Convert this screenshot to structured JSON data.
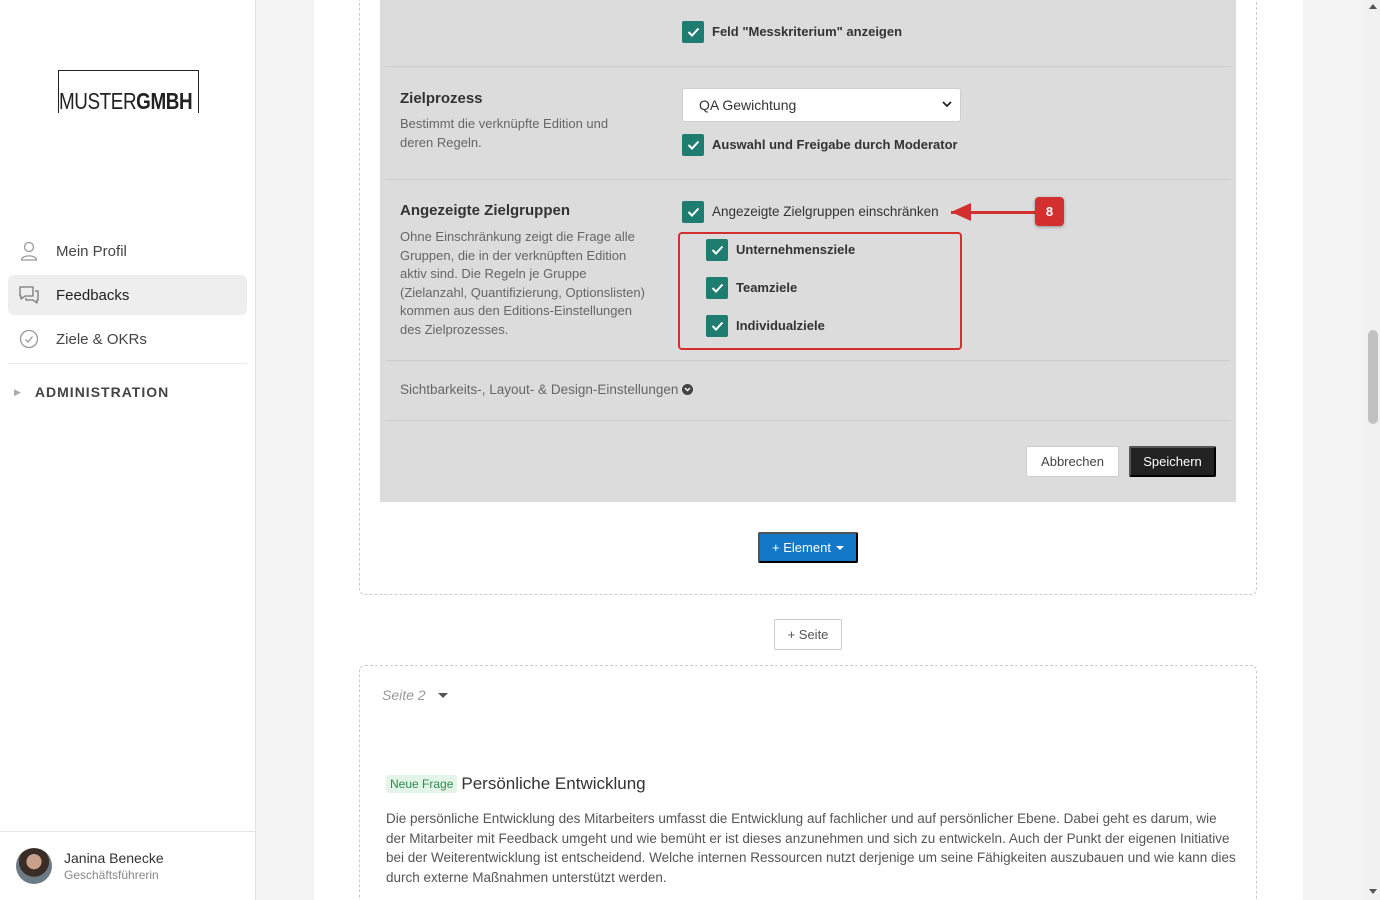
{
  "brand": {
    "logo_light": "MUSTER",
    "logo_bold": "GMBH"
  },
  "sidebar": {
    "items": [
      {
        "label": "Mein Profil",
        "icon": "user-icon"
      },
      {
        "label": "Feedbacks",
        "icon": "chat-icon",
        "active": true
      },
      {
        "label": "Ziele & OKRs",
        "icon": "check-circle-icon"
      }
    ],
    "admin_label": "ADMINISTRATION"
  },
  "user": {
    "name": "Janina Benecke",
    "role": "Geschäftsführerin"
  },
  "editor": {
    "messkriterium_label": "Feld \"Messkriterium\" anzeigen",
    "zielprozess": {
      "title": "Zielprozess",
      "desc": "Bestimmt die verknüpfte Edition und deren Regeln.",
      "select_value": "QA Gewichtung",
      "moderator_label": "Auswahl und Freigabe durch Moderator"
    },
    "zielgruppen": {
      "title": "Angezeigte Zielgruppen",
      "desc": "Ohne Einschränkung zeigt die Frage alle Gruppen, die in der verknüpften Edition aktiv sind. Die Regeln je Gruppe (Zielanzahl, Quantifizierung, Optionslisten) kommen aus den Editions-Einstellungen des Zielprozesses.",
      "restrict_label": "Angezeigte Zielgruppen einschränken",
      "groups": [
        "Unternehmensziele",
        "Teamziele",
        "Individualziele"
      ]
    },
    "visibility_link": "Sichtbarkeits-, Layout- & Design-Einstellungen",
    "cancel_label": "Abbrechen",
    "save_label": "Speichern"
  },
  "annotation": {
    "step_number": "8",
    "color": "#d32f2f"
  },
  "add_element_label": "+ Element",
  "add_page_label": "+ Seite",
  "page2": {
    "label": "Seite 2",
    "badge": "Neue Frage",
    "question_title": "Persönliche Entwicklung",
    "question_text": "Die persönliche Entwicklung des Mitarbeiters umfasst die Entwicklung auf fachlicher und auf persönlicher Ebene. Dabei geht es darum, wie der Mitarbeiter mit Feedback umgeht und wie bemüht er ist dieses anzunehmen und sich zu entwickeln. Auch der Punkt der eigenen Initiative bei der Weiterentwicklung ist entscheidend. Welche internen Ressourcen nutzt derjenige um seine Fähigkeiten auszubauen und wie kann dies durch externe Maßnahmen unterstützt werden."
  },
  "colors": {
    "accent_green": "#1e7d70",
    "primary_blue": "#1478c8",
    "dark_button": "#222222"
  }
}
